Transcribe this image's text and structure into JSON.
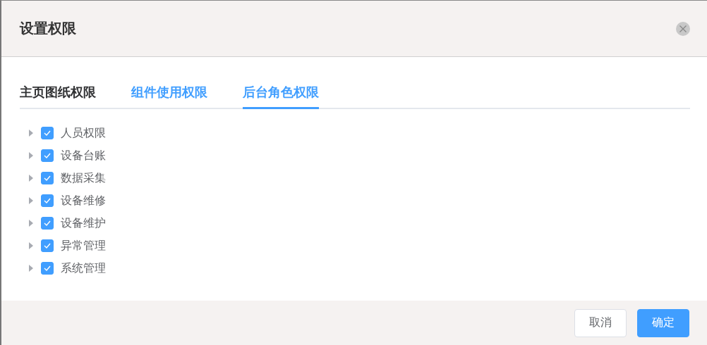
{
  "dialog": {
    "title": "设置权限"
  },
  "tabs": [
    {
      "label": "主页图纸权限",
      "selected": false,
      "hovered": false
    },
    {
      "label": "组件使用权限",
      "selected": false,
      "hovered": true
    },
    {
      "label": "后台角色权限",
      "selected": true,
      "hovered": false
    }
  ],
  "tree": [
    {
      "label": "人员权限",
      "checked": true,
      "expanded": false
    },
    {
      "label": "设备台账",
      "checked": true,
      "expanded": false
    },
    {
      "label": "数据采集",
      "checked": true,
      "expanded": false
    },
    {
      "label": "设备维修",
      "checked": true,
      "expanded": false
    },
    {
      "label": "设备维护",
      "checked": true,
      "expanded": false
    },
    {
      "label": "异常管理",
      "checked": true,
      "expanded": false
    },
    {
      "label": "系统管理",
      "checked": true,
      "expanded": false
    }
  ],
  "buttons": [
    {
      "label": "取消",
      "kind": "default"
    },
    {
      "label": "确定",
      "kind": "primary"
    }
  ]
}
